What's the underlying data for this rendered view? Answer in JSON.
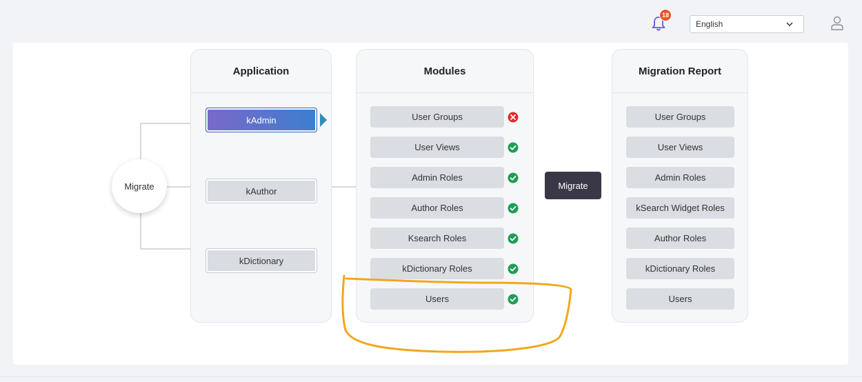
{
  "header": {
    "notification_count": "18",
    "language_selected": "English"
  },
  "migrate_node": {
    "label": "Migrate"
  },
  "application": {
    "title": "Application",
    "items": [
      {
        "label": "kAdmin",
        "active": true
      },
      {
        "label": "kAuthor",
        "active": false
      },
      {
        "label": "kDictionary",
        "active": false
      }
    ]
  },
  "modules": {
    "title": "Modules",
    "items": [
      {
        "label": "User Groups",
        "status": "error"
      },
      {
        "label": "User Views",
        "status": "success"
      },
      {
        "label": "Admin Roles",
        "status": "success"
      },
      {
        "label": "Author Roles",
        "status": "success"
      },
      {
        "label": "Ksearch Roles",
        "status": "success"
      },
      {
        "label": "kDictionary Roles",
        "status": "success"
      },
      {
        "label": "Users",
        "status": "success"
      }
    ]
  },
  "migrate_button": {
    "label": "Migrate"
  },
  "report": {
    "title": "Migration Report",
    "items": [
      {
        "label": "User Groups"
      },
      {
        "label": "User Views"
      },
      {
        "label": "Admin Roles"
      },
      {
        "label": "kSearch Widget Roles"
      },
      {
        "label": "Author Roles"
      },
      {
        "label": "kDictionary Roles"
      },
      {
        "label": "Users"
      }
    ]
  },
  "colors": {
    "active_gradient_start": "#7b68c9",
    "active_gradient_end": "#3b7fd0",
    "error": "#e02b2b",
    "success": "#1f9d55",
    "annotation": "#f2a71b",
    "badge": "#e8542b"
  }
}
